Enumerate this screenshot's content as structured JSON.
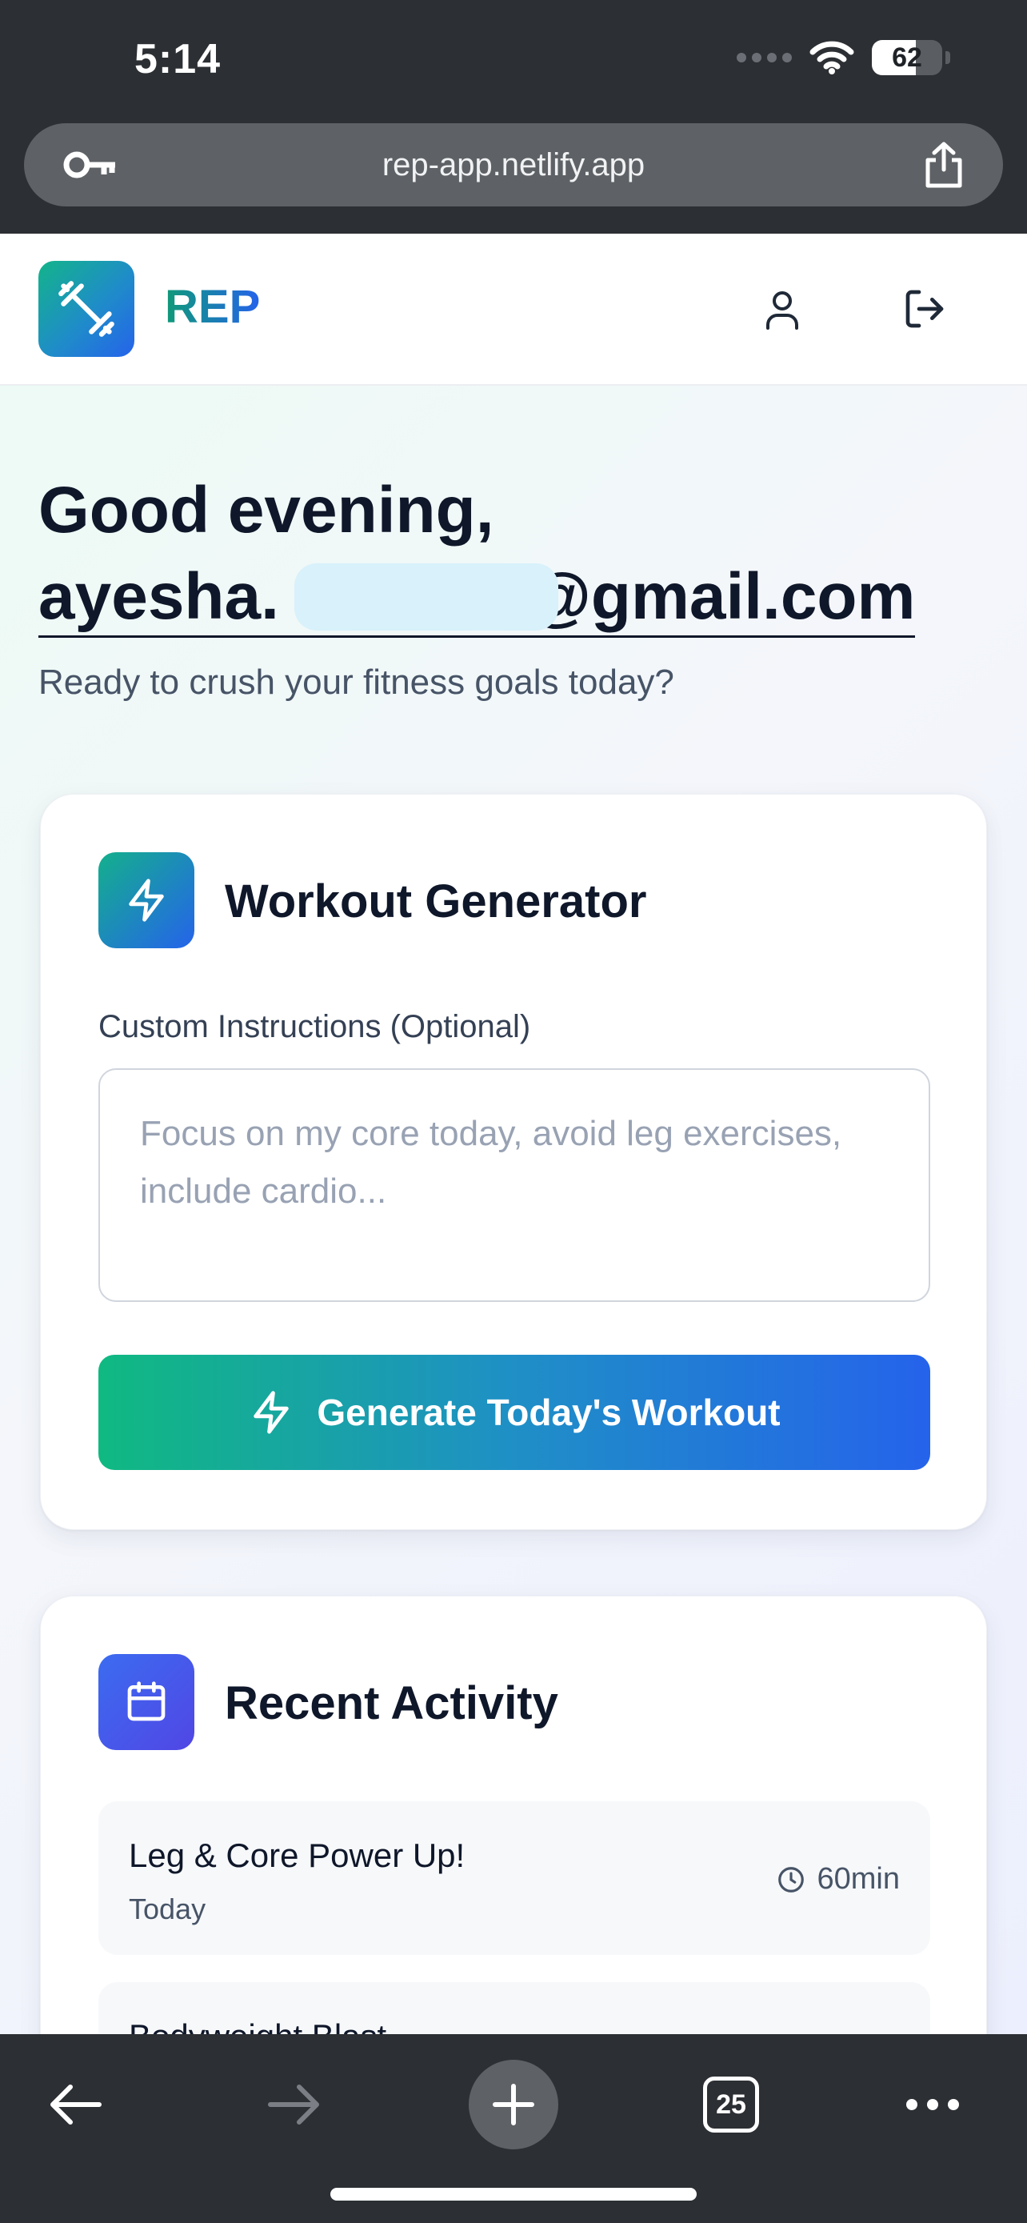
{
  "status_bar": {
    "time": "5:14",
    "battery_level": "62",
    "battery_fraction": 0.62,
    "icons": [
      "signal-dots-icon",
      "wifi-icon",
      "battery-icon"
    ]
  },
  "browser": {
    "url": "rep-app.netlify.app",
    "icons": [
      "key-icon",
      "share-icon"
    ]
  },
  "header": {
    "brand": "REP",
    "icons": [
      "dumbbell-icon",
      "user-icon",
      "logout-icon"
    ]
  },
  "greeting": {
    "line1": "Good evening,",
    "email_start": "ayesha.",
    "email_end": "@gmail.com",
    "subtitle": "Ready to crush your fitness goals today?"
  },
  "generator": {
    "title": "Workout Generator",
    "label": "Custom Instructions (Optional)",
    "placeholder": "Focus on my core today, avoid leg exercises, include cardio...",
    "value": "",
    "button_label": "Generate Today's Workout",
    "icons": [
      "lightning-icon"
    ]
  },
  "activity": {
    "title": "Recent Activity",
    "items": [
      {
        "title": "Leg & Core Power Up!",
        "date": "Today",
        "duration": "60min"
      },
      {
        "title": "Bodyweight Blast",
        "date": "",
        "duration": ""
      }
    ],
    "icons": [
      "calendar-icon",
      "clock-icon"
    ]
  },
  "toolbar": {
    "tab_count": "25",
    "icons": [
      "back-arrow-icon",
      "forward-arrow-icon",
      "plus-icon",
      "tabs-icon",
      "more-icon"
    ]
  },
  "colors": {
    "chrome": "#2c2f33",
    "brand_green": "#10b981",
    "brand_blue": "#2563eb",
    "activity_indigo": "#4f46e5"
  }
}
